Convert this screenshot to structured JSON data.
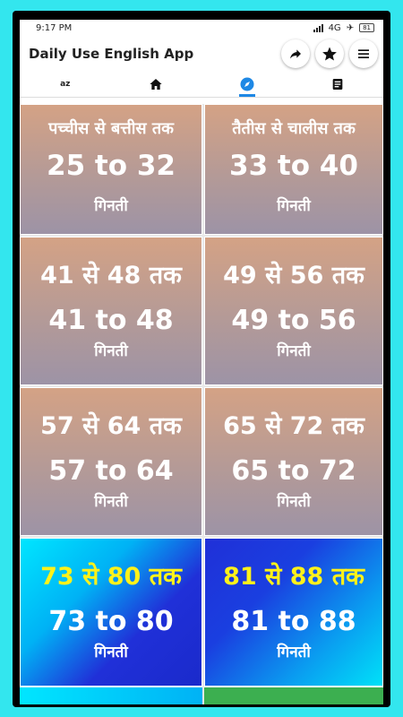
{
  "status": {
    "time": "9:17 PM",
    "network": "4G",
    "battery": "81"
  },
  "appbar": {
    "title": "Daily Use English App"
  },
  "tabs": [
    {
      "label": "az"
    }
  ],
  "cards": [
    {
      "title": "पच्चीस से बत्तीस तक",
      "range": "25 to 32",
      "label": "गिनती"
    },
    {
      "title": "तैतीस से चालीस तक",
      "range": "33 to 40",
      "label": "गिनती"
    },
    {
      "title": "41 से 48 तक",
      "range": "41 to 48",
      "label": "गिनती"
    },
    {
      "title": "49 से 56 तक",
      "range": "49 to 56",
      "label": "गिनती"
    },
    {
      "title": "57 से 64 तक",
      "range": "57 to 64",
      "label": "गिनती"
    },
    {
      "title": "65 से 72 तक",
      "range": "65 to 72",
      "label": "गिनती"
    },
    {
      "title": "73 से 80 तक",
      "range": "73 to 80",
      "label": "गिनती"
    },
    {
      "title": "81 से 88 तक",
      "range": "81 to 88",
      "label": "गिनती"
    }
  ],
  "colors": {
    "accent": "#1e88e5",
    "highlight": "#fff21a",
    "background": "#33e6ee"
  }
}
